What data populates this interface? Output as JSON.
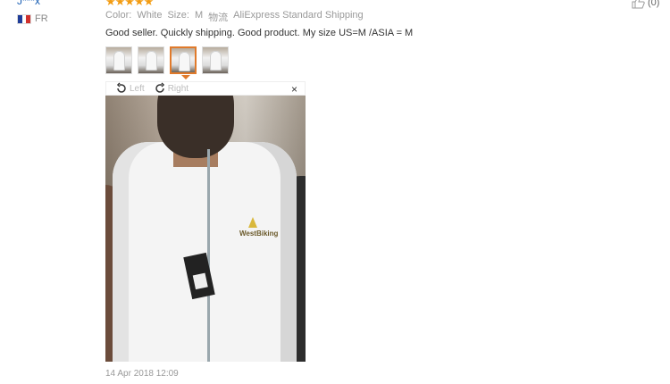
{
  "reviewer": {
    "name": "J***x",
    "country": "FR",
    "flag_colors": [
      "#1f3d99",
      "#ffffff",
      "#d0312d"
    ]
  },
  "review": {
    "rating_stars": "★★★★★",
    "rating": 5,
    "color_label": "Color:",
    "color_value": "White",
    "size_label": "Size:",
    "size_value": "M",
    "shipping_label": "物流",
    "shipping_value": "AliExpress Standard Shipping",
    "text": "Good seller. Quickly shipping. Good product. My size US=M /ASIA = M",
    "date": "14 Apr 2018 12:09"
  },
  "helpful": {
    "count": "(0)",
    "icon": "thumbs-up-icon"
  },
  "viewer": {
    "rotate_left": "Left",
    "rotate_right": "Right",
    "close": "×"
  },
  "colors": {
    "accent": "#e07a2b",
    "star": "#f39c12",
    "link": "#1a5fb4"
  }
}
